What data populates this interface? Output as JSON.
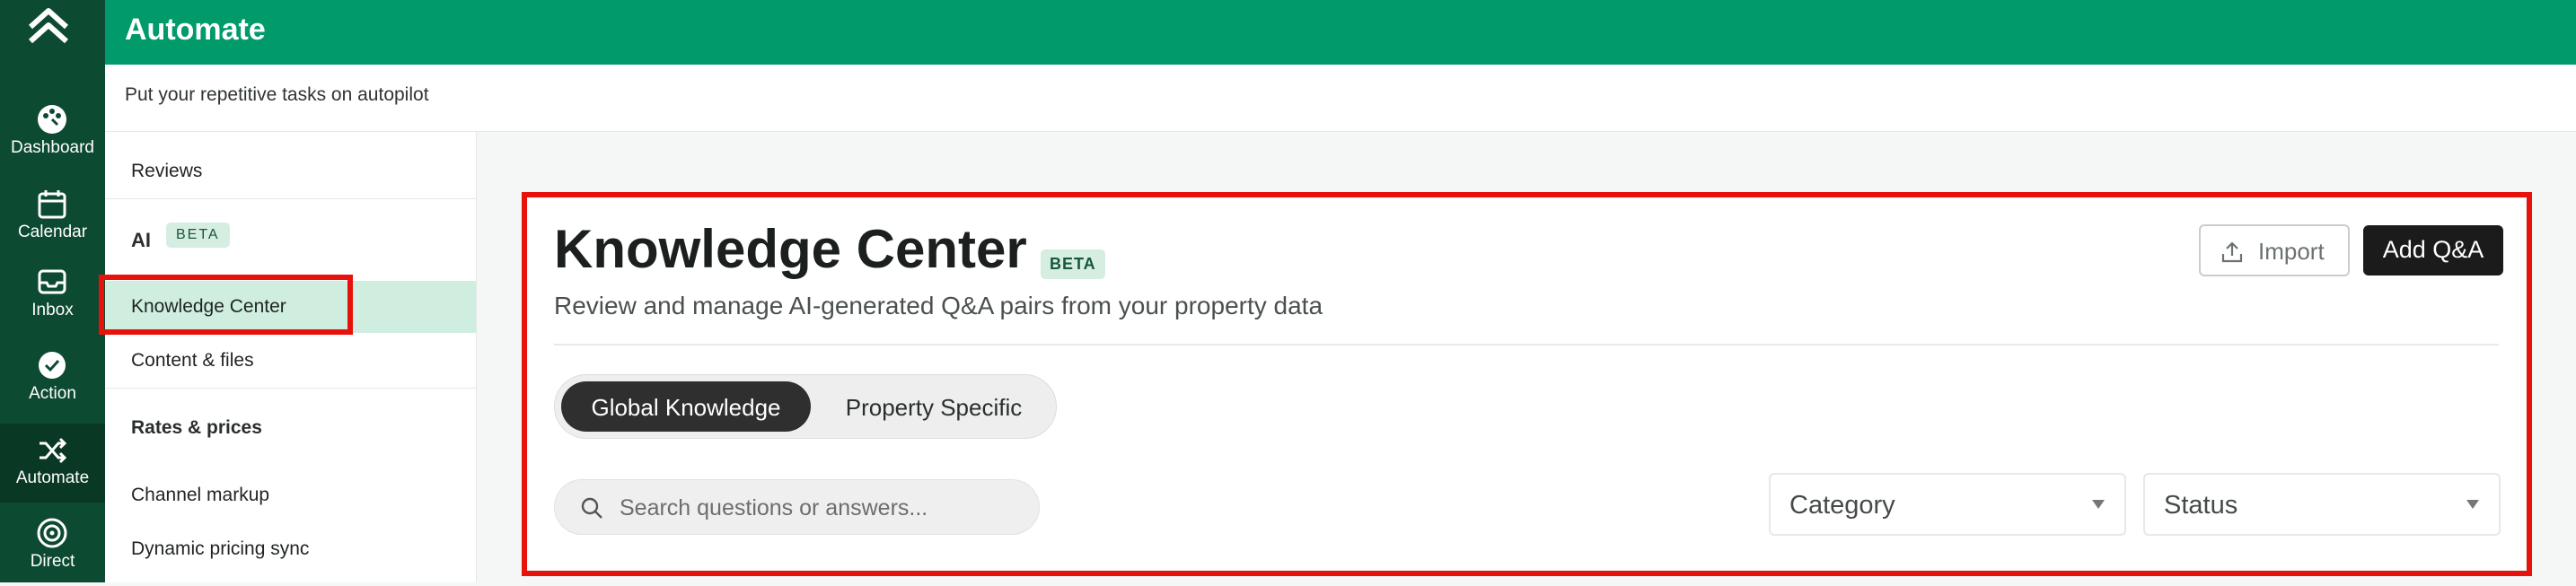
{
  "app": {
    "title": "Automate",
    "tagline": "Put your repetitive tasks on autopilot"
  },
  "rail": {
    "logo_icon": "chevrons-up-logo",
    "items": [
      {
        "label": "Dashboard",
        "icon": "palette-icon"
      },
      {
        "label": "Calendar",
        "icon": "calendar-icon"
      },
      {
        "label": "Inbox",
        "icon": "inbox-icon"
      },
      {
        "label": "Action",
        "icon": "check-circle-icon"
      },
      {
        "label": "Automate",
        "icon": "shuffle-icon",
        "active": true
      },
      {
        "label": "Direct",
        "icon": "target-icon"
      }
    ]
  },
  "sidebar": {
    "reviews": "Reviews",
    "ai_section": {
      "label": "AI",
      "badge": "BETA"
    },
    "knowledge_center": "Knowledge Center",
    "content_files": "Content & files",
    "rates_section": "Rates & prices",
    "channel_markup": "Channel markup",
    "dynamic_pricing": "Dynamic pricing sync"
  },
  "main": {
    "title": "Knowledge Center",
    "badge": "BETA",
    "description": "Review and manage AI-generated Q&A pairs from your property data",
    "import_label": "Import",
    "add_label": "Add Q&A",
    "tabs": [
      {
        "label": "Global Knowledge",
        "active": true
      },
      {
        "label": "Property Specific",
        "active": false
      }
    ],
    "search_placeholder": "Search questions or answers...",
    "category_select": "Category",
    "status_select": "Status"
  },
  "colors": {
    "rail": "#0d4a32",
    "topbar": "#009a6b",
    "selected_item": "#cfeee0",
    "highlight_outline": "#e8120c",
    "primary_button": "#1b1b1b"
  }
}
